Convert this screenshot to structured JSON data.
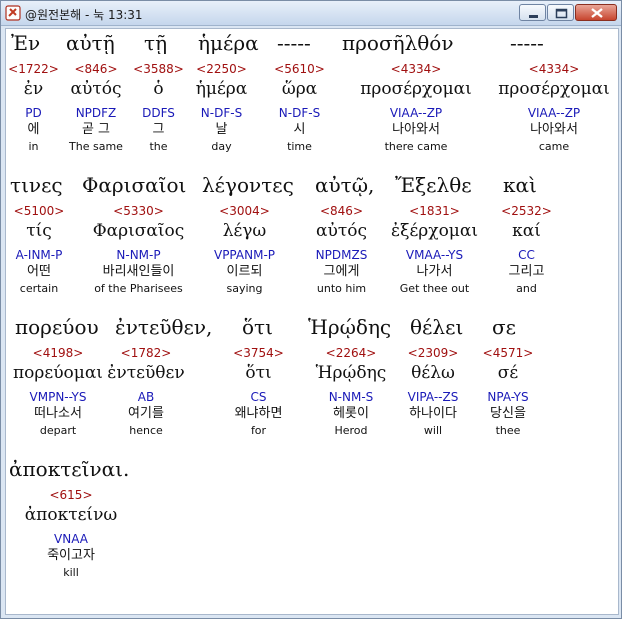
{
  "window": {
    "title": "@원전본해 - 눅 13:31",
    "icon": "bible-app-icon"
  },
  "lines": [
    {
      "greek": [
        "Ἐν",
        "αὐτῇ",
        "τῇ",
        "ἡμέρα",
        "-----",
        "προσῆλθόν",
        "-----"
      ],
      "words": [
        {
          "strong": "<1722>",
          "lemma": "ἐν",
          "morph": "PD",
          "korean": "에",
          "english": "in"
        },
        {
          "strong": "<846>",
          "lemma": "αὐτός",
          "morph": "NPDFZ",
          "korean": "곧 그",
          "english": "The same"
        },
        {
          "strong": "<3588>",
          "lemma": "ὁ",
          "morph": "DDFS",
          "korean": "그",
          "english": "the"
        },
        {
          "strong": "<2250>",
          "lemma": "ἡμέρα",
          "morph": "N-DF-S",
          "korean": "날",
          "english": "day"
        },
        {
          "strong": "<5610>",
          "lemma": "ὥρα",
          "morph": "N-DF-S",
          "korean": "시",
          "english": "time"
        },
        {
          "strong": "<4334>",
          "lemma": "προσέρχομαι",
          "morph": "VIAA--ZP",
          "korean": "나아와서",
          "english": "there came"
        },
        {
          "strong": "<4334>",
          "lemma": "προσέρχομαι",
          "morph": "VIAA--ZP",
          "korean": "나아와서",
          "english": "came"
        }
      ]
    },
    {
      "greek": [
        "τινες",
        "Φαρισαῖοι",
        "λέγοντες",
        "αὐτῷ,",
        "Ἔξελθε",
        "καὶ"
      ],
      "words": [
        {
          "strong": "<5100>",
          "lemma": "τίς",
          "morph": "A-INM-P",
          "korean": "어떤",
          "english": "certain"
        },
        {
          "strong": "<5330>",
          "lemma": "Φαρισαῖος",
          "morph": "N-NM-P",
          "korean": "바리새인들이",
          "english": "of the Pharisees"
        },
        {
          "strong": "<3004>",
          "lemma": "λέγω",
          "morph": "VPPANM-P",
          "korean": "이르되",
          "english": "saying"
        },
        {
          "strong": "<846>",
          "lemma": "αὐτός",
          "morph": "NPDMZS",
          "korean": "그에게",
          "english": "unto him"
        },
        {
          "strong": "<1831>",
          "lemma": "ἐξέρχομαι",
          "morph": "VMAA--YS",
          "korean": "나가서",
          "english": "Get thee out"
        },
        {
          "strong": "<2532>",
          "lemma": "καί",
          "morph": "CC",
          "korean": "그리고",
          "english": "and"
        }
      ]
    },
    {
      "greek": [
        "πορεύου",
        "ἐντεῦθεν,",
        "ὅτι",
        "Ἡρῴδης",
        "θέλει",
        "σε"
      ],
      "words": [
        {
          "strong": "<4198>",
          "lemma": "πορεύομαι",
          "morph": "VMPN--YS",
          "korean": "떠나소서",
          "english": "depart"
        },
        {
          "strong": "<1782>",
          "lemma": "ἐντεῦθεν",
          "morph": "AB",
          "korean": "여기를",
          "english": "hence"
        },
        {
          "strong": "<3754>",
          "lemma": "ὅτι",
          "morph": "CS",
          "korean": "왜냐하면",
          "english": "for"
        },
        {
          "strong": "<2264>",
          "lemma": "Ἡρῴδης",
          "morph": "N-NM-S",
          "korean": "헤롯이",
          "english": "Herod"
        },
        {
          "strong": "<2309>",
          "lemma": "θέλω",
          "morph": "VIPA--ZS",
          "korean": "하나이다",
          "english": "will"
        },
        {
          "strong": "<4571>",
          "lemma": "σέ",
          "morph": "NPA-YS",
          "korean": "당신을",
          "english": "thee"
        }
      ]
    },
    {
      "greek": [
        "ἀποκτεῖναι."
      ],
      "words": [
        {
          "strong": "<615>",
          "lemma": "ἀποκτείνω",
          "morph": "VNAA",
          "korean": "죽이고자",
          "english": "kill"
        }
      ]
    }
  ]
}
